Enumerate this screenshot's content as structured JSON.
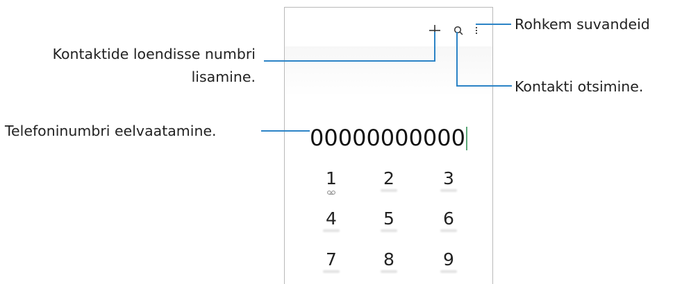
{
  "dialer": {
    "toolbar": {
      "add_icon": "plus-icon",
      "search_icon": "search-icon",
      "more_icon": "more-vertical-icon"
    },
    "number": "00000000000",
    "keys": [
      {
        "digit": "1",
        "sub_icon": "voicemail-icon"
      },
      {
        "digit": "2"
      },
      {
        "digit": "3"
      },
      {
        "digit": "4"
      },
      {
        "digit": "5"
      },
      {
        "digit": "6"
      },
      {
        "digit": "7"
      },
      {
        "digit": "8"
      },
      {
        "digit": "9"
      }
    ]
  },
  "callouts": {
    "more_options": "Rohkem suvandeid",
    "add_contact_line1": "Kontaktide loendisse numbri",
    "add_contact_line2": "lisamine.",
    "search_contact": "Kontakti otsimine.",
    "preview_number": "Telefoninumbri eelvaatamine."
  },
  "colors": {
    "callout_line": "#2b83c6",
    "caret": "#5aa777"
  }
}
